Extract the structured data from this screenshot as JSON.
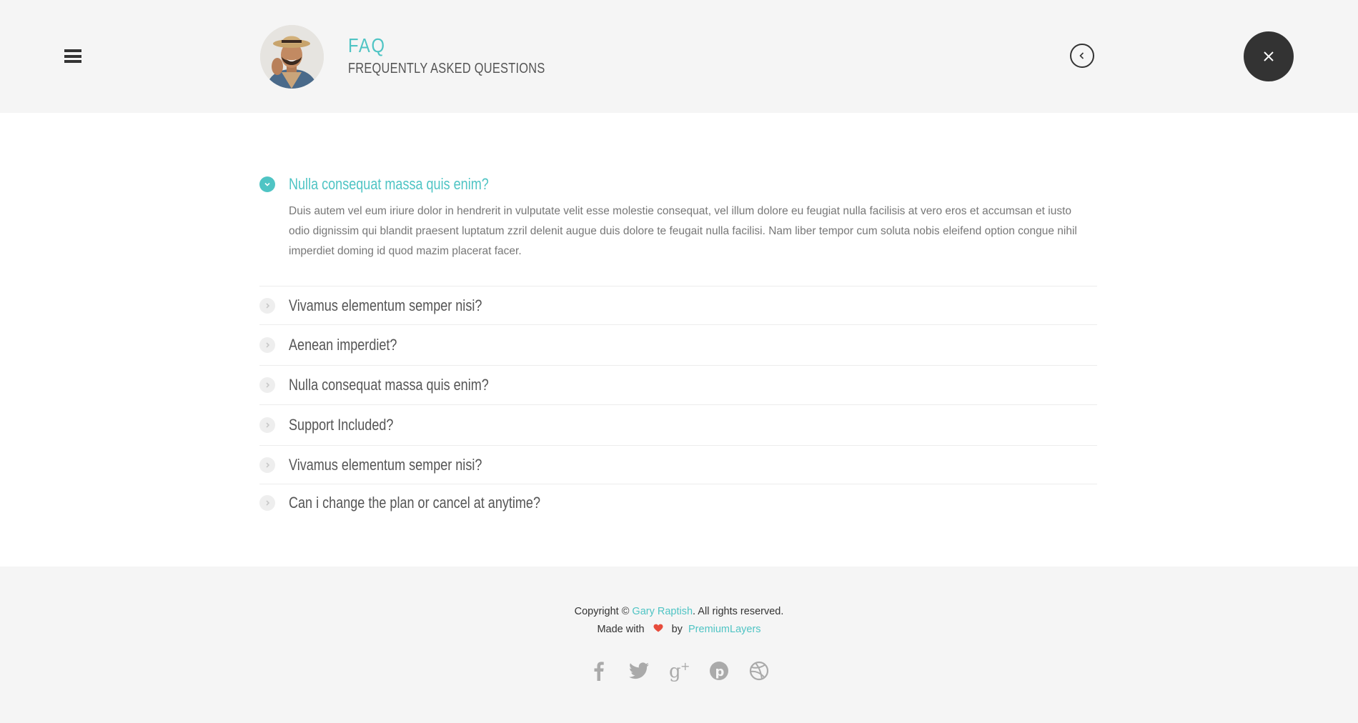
{
  "header": {
    "title": "FAQ",
    "subtitle": "FREQUENTLY ASKED QUESTIONS"
  },
  "faq": [
    {
      "question": "Nulla consequat massa quis enim?",
      "answer": "Duis autem vel eum iriure dolor in hendrerit in vulputate velit esse molestie consequat, vel illum dolore eu feugiat nulla facilisis at vero eros et accumsan et iusto odio dignissim qui blandit praesent luptatum zzril delenit augue duis dolore te feugait nulla facilisi. Nam liber tempor cum soluta nobis eleifend option congue nihil imperdiet doming id quod mazim placerat facer.",
      "open": true
    },
    {
      "question": "Vivamus elementum semper nisi?",
      "open": false
    },
    {
      "question": "Aenean imperdiet?",
      "open": false
    },
    {
      "question": "Nulla consequat massa quis enim?",
      "open": false
    },
    {
      "question": "Support Included?",
      "open": false
    },
    {
      "question": "Vivamus elementum semper nisi?",
      "open": false
    },
    {
      "question": "Can i change the plan or cancel at anytime?",
      "open": false
    }
  ],
  "footer": {
    "copyright_prefix": "Copyright ©",
    "author": "Gary Raptish",
    "copyright_suffix": ". All rights reserved.",
    "made_with": "Made with",
    "by": "by",
    "company": "PremiumLayers",
    "socials": [
      "facebook-icon",
      "twitter-icon",
      "google-plus-icon",
      "pinterest-icon",
      "dribbble-icon"
    ]
  },
  "colors": {
    "accent": "#4fc4c4",
    "dark": "#333333",
    "header_bg": "#f5f5f5",
    "heart": "#e74c3c"
  }
}
